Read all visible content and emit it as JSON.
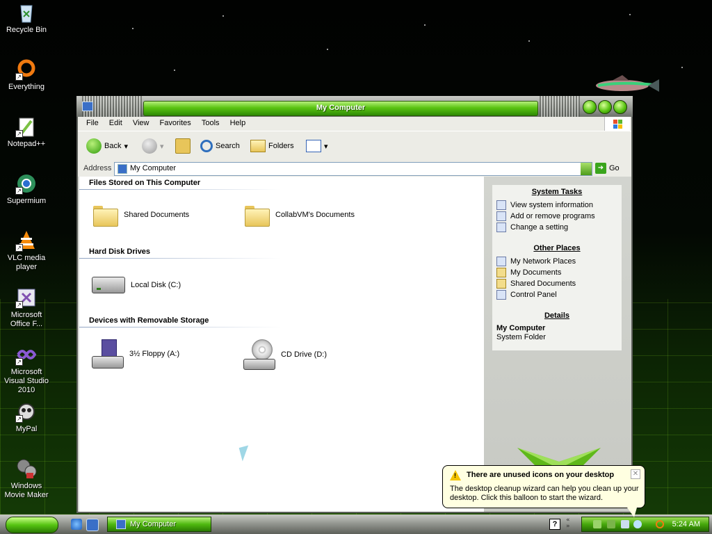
{
  "desktop": {
    "icons": [
      {
        "label": "Recycle Bin",
        "icon": "recycle-bin-icon"
      },
      {
        "label": "Everything",
        "icon": "everything-icon"
      },
      {
        "label": "Notepad++",
        "icon": "notepadpp-icon"
      },
      {
        "label": "Supermium",
        "icon": "supermium-icon"
      },
      {
        "label": "VLC media player",
        "icon": "vlc-icon"
      },
      {
        "label": "Microsoft Office F...",
        "icon": "office-icon"
      },
      {
        "label": "Microsoft Visual Studio 2010",
        "icon": "visual-studio-icon"
      },
      {
        "label": "MyPal",
        "icon": "mypal-icon"
      },
      {
        "label": "Windows Movie Maker",
        "icon": "movie-maker-icon"
      }
    ]
  },
  "window": {
    "title": "My Computer",
    "menu": [
      "File",
      "Edit",
      "View",
      "Favorites",
      "Tools",
      "Help"
    ],
    "toolbar": {
      "back": "Back",
      "search": "Search",
      "folders": "Folders"
    },
    "address": {
      "label": "Address",
      "value": "My Computer",
      "go": "Go"
    },
    "groups": {
      "stored": {
        "title": "Files Stored on This Computer",
        "items": [
          "Shared Documents",
          "CollabVM's Documents"
        ]
      },
      "hdd": {
        "title": "Hard Disk Drives",
        "items": [
          "Local Disk (C:)"
        ]
      },
      "removable": {
        "title": "Devices with Removable Storage",
        "items": [
          "3½ Floppy (A:)",
          "CD Drive (D:)"
        ]
      }
    },
    "taskpane": {
      "system_tasks": {
        "title": "System Tasks",
        "links": [
          "View system information",
          "Add or remove programs",
          "Change a setting"
        ]
      },
      "other_places": {
        "title": "Other Places",
        "links": [
          "My Network Places",
          "My Documents",
          "Shared Documents",
          "Control Panel"
        ]
      },
      "details": {
        "title": "Details",
        "name": "My Computer",
        "type": "System Folder"
      }
    }
  },
  "taskbar": {
    "task_button": "My Computer",
    "clock": "5:24 AM"
  },
  "balloon": {
    "title": "There are unused icons on your desktop",
    "text": "The desktop cleanup wizard can help you clean up your desktop. Click this balloon to start the wizard."
  },
  "colors": {
    "accent_green": "#4fb910",
    "balloon_bg": "#ffffe1",
    "taskpane_bg": "#f1f2ee"
  }
}
